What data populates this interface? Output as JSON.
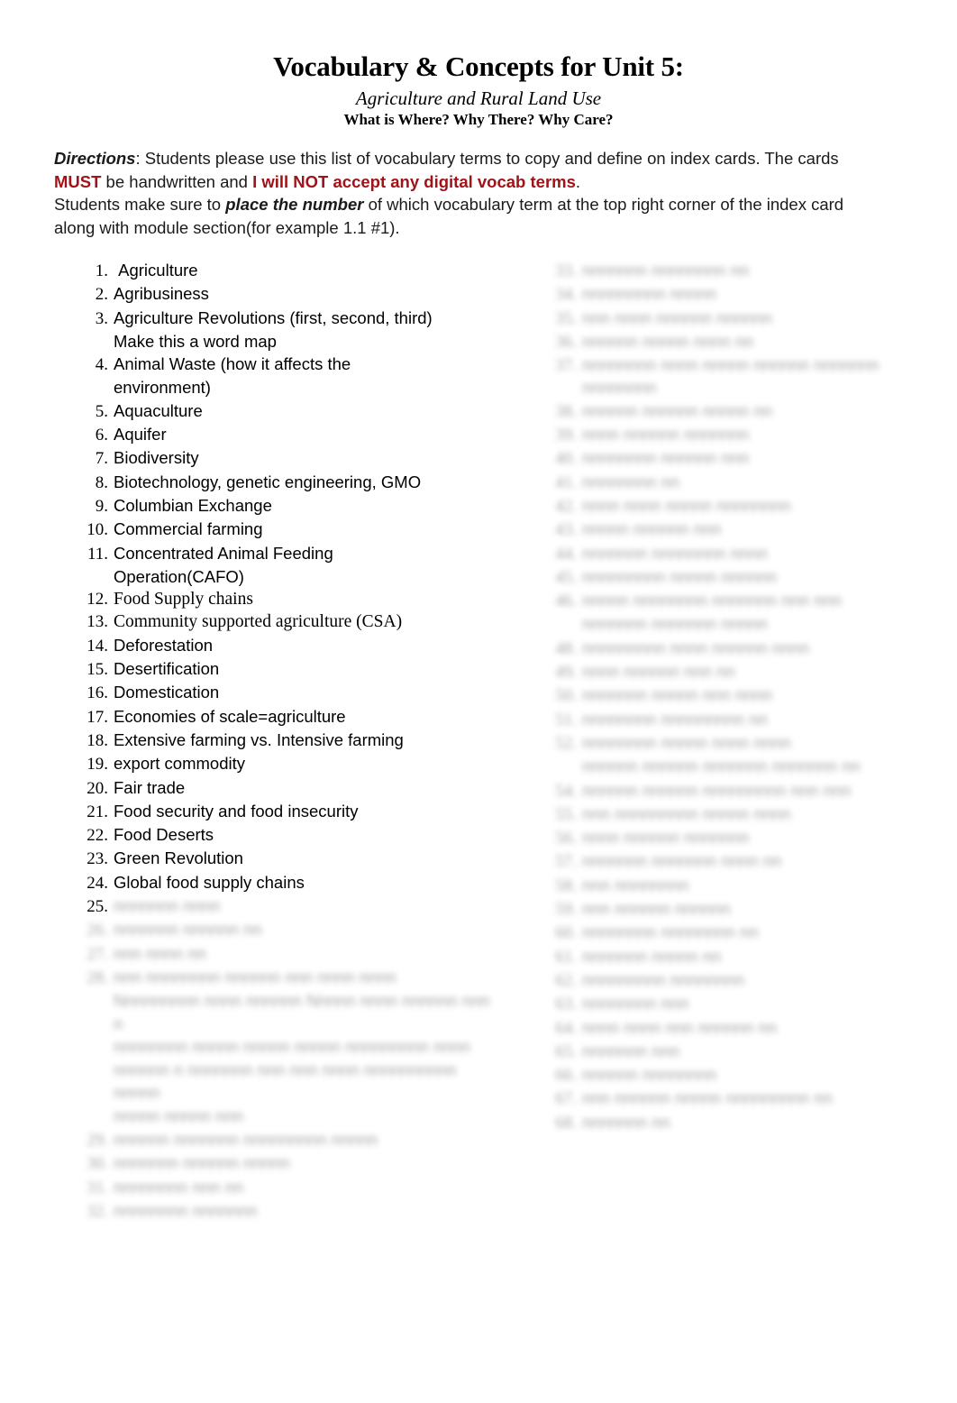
{
  "document": {
    "title": "Vocabulary & Concepts for Unit 5:",
    "subtitle": "Agriculture and Rural Land Use",
    "tagline": "What is Where? Why There? Why Care?"
  },
  "directions": {
    "label": "Directions",
    "line1_a": ":  Students please use this list of vocabulary terms to copy and define on index cards.  The cards ",
    "must": "MUST",
    "line2_a": " be handwritten and ",
    "no_digital": "I will NOT accept any digital vocab terms",
    "line2_b": ".",
    "line3_a": "Students make sure to ",
    "place_number": "place the number",
    "line3_b": " of which vocabulary term at the top right corner of the index card along with module section(for example 1.1 #1)."
  },
  "colors": {
    "emphasis_red": "#A01318",
    "body_text": "#000000",
    "page_background": "#FFFFFF"
  },
  "vocab_left": [
    {
      "num": "1.",
      "text": " Agriculture"
    },
    {
      "num": "2.",
      "text": "Agribusiness"
    },
    {
      "num": "3.",
      "text": "Agriculture Revolutions (first, second, third)",
      "cont": "Make this a word map"
    },
    {
      "num": "4.",
      "text": "Animal Waste (how it affects the",
      "cont": "environment)"
    },
    {
      "num": "5.",
      "text": "Aquaculture"
    },
    {
      "num": "6.",
      "text": "Aquifer"
    },
    {
      "num": "7.",
      "text": "Biodiversity"
    },
    {
      "num": "8.",
      "text": "Biotechnology, genetic engineering, GMO"
    },
    {
      "num": "9.",
      "text": "Columbian Exchange"
    },
    {
      "num": "10.",
      "text": "Commercial farming"
    },
    {
      "num": "11.",
      "text": "Concentrated Animal Feeding",
      "cont": "Operation(CAFO)"
    },
    {
      "num": "12.",
      "text": "Food Supply chains",
      "serif": true
    },
    {
      "num": "13.",
      "text": "Community supported agriculture (CSA)",
      "serif": true
    },
    {
      "num": "14.",
      "text": "Deforestation"
    },
    {
      "num": "15.",
      "text": "Desertification"
    },
    {
      "num": "16.",
      "text": "Domestication"
    },
    {
      "num": "17.",
      "text": "Economies of scale=agriculture"
    },
    {
      "num": "18.",
      "text": "Extensive farming vs. Intensive farming"
    },
    {
      "num": "19.",
      "text": "export commodity"
    },
    {
      "num": "20.",
      "text": "Fair trade"
    },
    {
      "num": "21.",
      "text": "Food security and food insecurity"
    },
    {
      "num": "22.",
      "text": "Food Deserts"
    },
    {
      "num": "23.",
      "text": "Green Revolution"
    },
    {
      "num": "24.",
      "text": "Global food supply chains"
    }
  ],
  "vocab_left_partial": {
    "num": "25.",
    "text": ""
  },
  "obscured_left": [
    {
      "num": "26.",
      "len": 17
    },
    {
      "num": "27.",
      "len": 10
    },
    {
      "num": "28.",
      "len": 33,
      "cont": [
        "Nnnnnnnnn nnnn nnnnnn  Nnnnn nnnn nnnnnn nnn n",
        "nnnnnnnn nnnnn nnnnn nnnnn nnnnnnnnn nnnn",
        "nnnnnn n nnnnnnn nnn nnn nnnn nnnnnnnnnn nnnnn",
        "nnnnn nnnnn nnn"
      ]
    },
    {
      "num": "29.",
      "len": 30
    },
    {
      "num": "30.",
      "len": 21
    },
    {
      "num": "31.",
      "len": 14
    },
    {
      "num": "32.",
      "len": 16
    }
  ],
  "obscured_right": [
    {
      "num": "33.",
      "len": 19
    },
    {
      "num": "34.",
      "len": 15
    },
    {
      "num": "35.",
      "len": 22
    },
    {
      "num": "36.",
      "len": 20
    },
    {
      "num": "37.",
      "len": 43
    },
    {
      "num": "38.",
      "len": 21
    },
    {
      "num": "39.",
      "len": 19
    },
    {
      "num": "40.",
      "len": 19
    },
    {
      "num": "41.",
      "len": 10
    },
    {
      "num": "42.",
      "len": 24
    },
    {
      "num": "43.",
      "len": 16
    },
    {
      "num": "44.",
      "len": 21
    },
    {
      "num": "45.",
      "len": 22
    },
    {
      "num": "46.",
      "len": 30
    },
    {
      "num": "47.",
      "len": 21,
      "cont_of": true
    },
    {
      "num": "48.",
      "len": 26
    },
    {
      "num": "49.",
      "len": 18
    },
    {
      "num": "50.",
      "len": 23
    },
    {
      "num": "51.",
      "len": 20
    },
    {
      "num": "52.",
      "len": 24
    },
    {
      "num": "53.",
      "len": 31,
      "cont_of": true
    },
    {
      "num": "54.",
      "len": 31
    },
    {
      "num": "55.",
      "len": 24
    },
    {
      "num": "56.",
      "len": 19
    },
    {
      "num": "57.",
      "len": 22
    },
    {
      "num": "58.",
      "len": 13
    },
    {
      "num": "59.",
      "len": 17
    },
    {
      "num": "60.",
      "len": 19
    },
    {
      "num": "61.",
      "len": 16
    },
    {
      "num": "62.",
      "len": 18
    },
    {
      "num": "63.",
      "len": 12
    },
    {
      "num": "64.",
      "len": 23
    },
    {
      "num": "65.",
      "len": 11
    },
    {
      "num": "66.",
      "len": 16
    },
    {
      "num": "67.",
      "len": 29
    },
    {
      "num": "68.",
      "len": 10
    }
  ]
}
